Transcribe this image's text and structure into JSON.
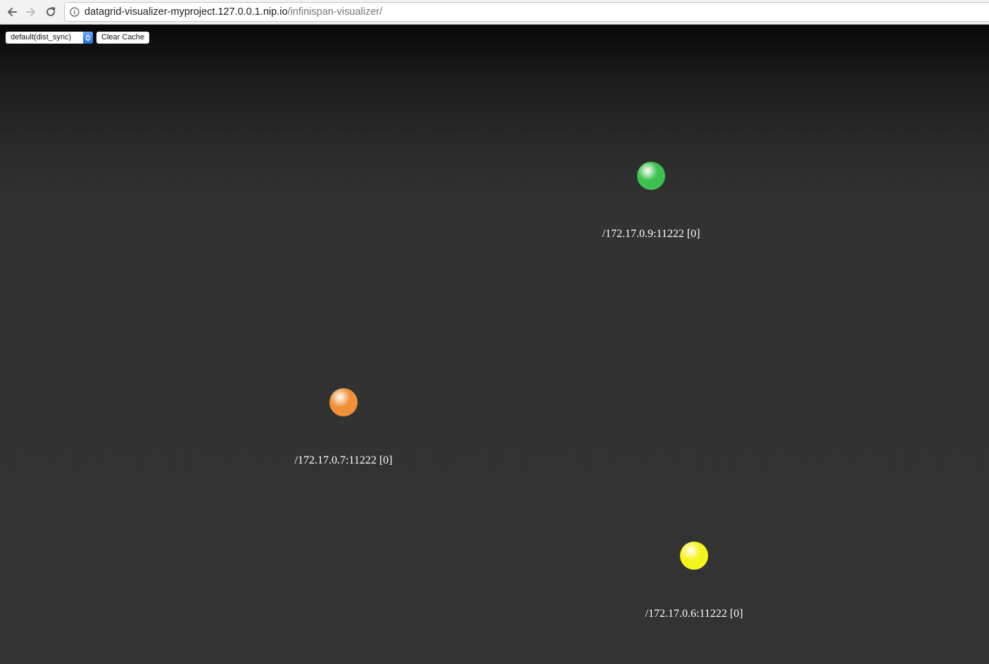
{
  "browser": {
    "url_host": "datagrid-visualizer-myproject.127.0.0.1.nip.io",
    "url_path": "/infinispan-visualizer/",
    "icons": [
      "back-arrow-icon",
      "forward-arrow-icon",
      "reload-icon",
      "info-icon"
    ]
  },
  "toolbar": {
    "cache_select_value": "default(dist_sync)",
    "clear_cache_label": "Clear Cache"
  },
  "nodes": [
    {
      "label": "/172.17.0.9:11222 [0]",
      "color": "#3dc24f"
    },
    {
      "label": "/172.17.0.7:11222 [0]",
      "color": "#f0913a"
    },
    {
      "label": "/172.17.0.6:11222 [0]",
      "color": "#f5f51e"
    }
  ]
}
